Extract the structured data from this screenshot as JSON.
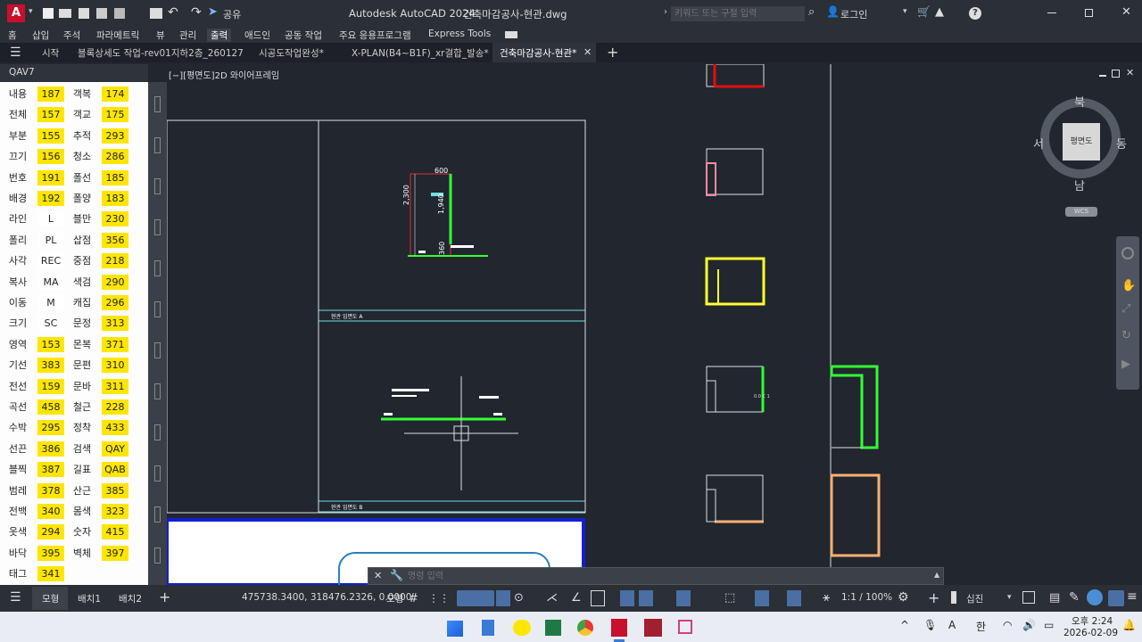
{
  "titlebar": {
    "app_title": "Autodesk AutoCAD 2024",
    "doc_title": "건축마감공사-현관.dwg",
    "share_label": "공유",
    "search_placeholder": "키워드 또는 구절 입력",
    "login_label": "로그인",
    "help_label": "?",
    "logo_letter": "A"
  },
  "ribbon": {
    "tabs": [
      "홈",
      "삽입",
      "주석",
      "파라메트릭",
      "뷰",
      "관리",
      "출력",
      "애드인",
      "공동 작업",
      "주요 응용프로그램",
      "Express Tools"
    ],
    "active": "출력"
  },
  "doctabs": {
    "start": "시작",
    "tabs": [
      "블록상세도 작업-rev01지하2층_260127",
      "시공도작업완성*",
      "X-PLAN(B4~B1F)_xr결합_발송*",
      "건축마감공사-현관*"
    ],
    "active": "건축마감공사-현관*",
    "plus": "+"
  },
  "panel": {
    "title": "QAV7",
    "rows": [
      [
        "내용",
        "187",
        "객복",
        "174"
      ],
      [
        "전체",
        "157",
        "객교",
        "175"
      ],
      [
        "부분",
        "155",
        "추적",
        "293"
      ],
      [
        "끄기",
        "156",
        "청소",
        "286"
      ],
      [
        "번호",
        "191",
        "폴선",
        "185"
      ],
      [
        "배경",
        "192",
        "폴양",
        "183"
      ],
      [
        "라인",
        "L",
        "블만",
        "230"
      ],
      [
        "폴리",
        "PL",
        "삽점",
        "356"
      ],
      [
        "사각",
        "REC",
        "중점",
        "218"
      ],
      [
        "복사",
        "MA",
        "색검",
        "290"
      ],
      [
        "이동",
        "M",
        "캐집",
        "296"
      ],
      [
        "크기",
        "SC",
        "문정",
        "313"
      ],
      [
        "영역",
        "153",
        "몬복",
        "371"
      ],
      [
        "기선",
        "383",
        "문편",
        "310"
      ],
      [
        "전선",
        "159",
        "문바",
        "311"
      ],
      [
        "곡선",
        "458",
        "철근",
        "228"
      ],
      [
        "수박",
        "295",
        "정착",
        "433"
      ],
      [
        "선끈",
        "386",
        "검색",
        "QAY"
      ],
      [
        "블찍",
        "387",
        "길표",
        "QAB"
      ],
      [
        "범레",
        "378",
        "산근",
        "385"
      ],
      [
        "전백",
        "340",
        "몸색",
        "323"
      ],
      [
        "옷색",
        "294",
        "숫자",
        "415"
      ],
      [
        "바닥",
        "395",
        "벽체",
        "397"
      ],
      [
        "태그",
        "341",
        "",
        ""
      ]
    ]
  },
  "viewport": {
    "label": "[−][평면도]2D 와이어프레임",
    "viewcube": {
      "north": "북",
      "south": "남",
      "east": "동",
      "west": "서",
      "face": "평면도",
      "wcs": "WCS"
    },
    "dims": {
      "width": "600",
      "h1": "2,300",
      "h2": "1,940",
      "h3": "360"
    },
    "section_a": "현관 입면도 A",
    "section_b": "현관 입면도 B",
    "small_text": "0.0 C 1"
  },
  "command": {
    "placeholder": "명령 입력"
  },
  "statusbar": {
    "tabs": [
      "모형",
      "배치1",
      "배치2"
    ],
    "coords": "475738.3400, 318476.2326, 0.0000",
    "model": "모형",
    "scale": "1:1 / 100%",
    "units": "십진"
  },
  "taskbar": {
    "time": "오후 2:24",
    "date": "2026-02-09",
    "ime1": "A",
    "ime2": "한"
  },
  "colors": {
    "accent": "#e8112d",
    "highlight": "#ffe600",
    "canvas": "#21262f"
  }
}
